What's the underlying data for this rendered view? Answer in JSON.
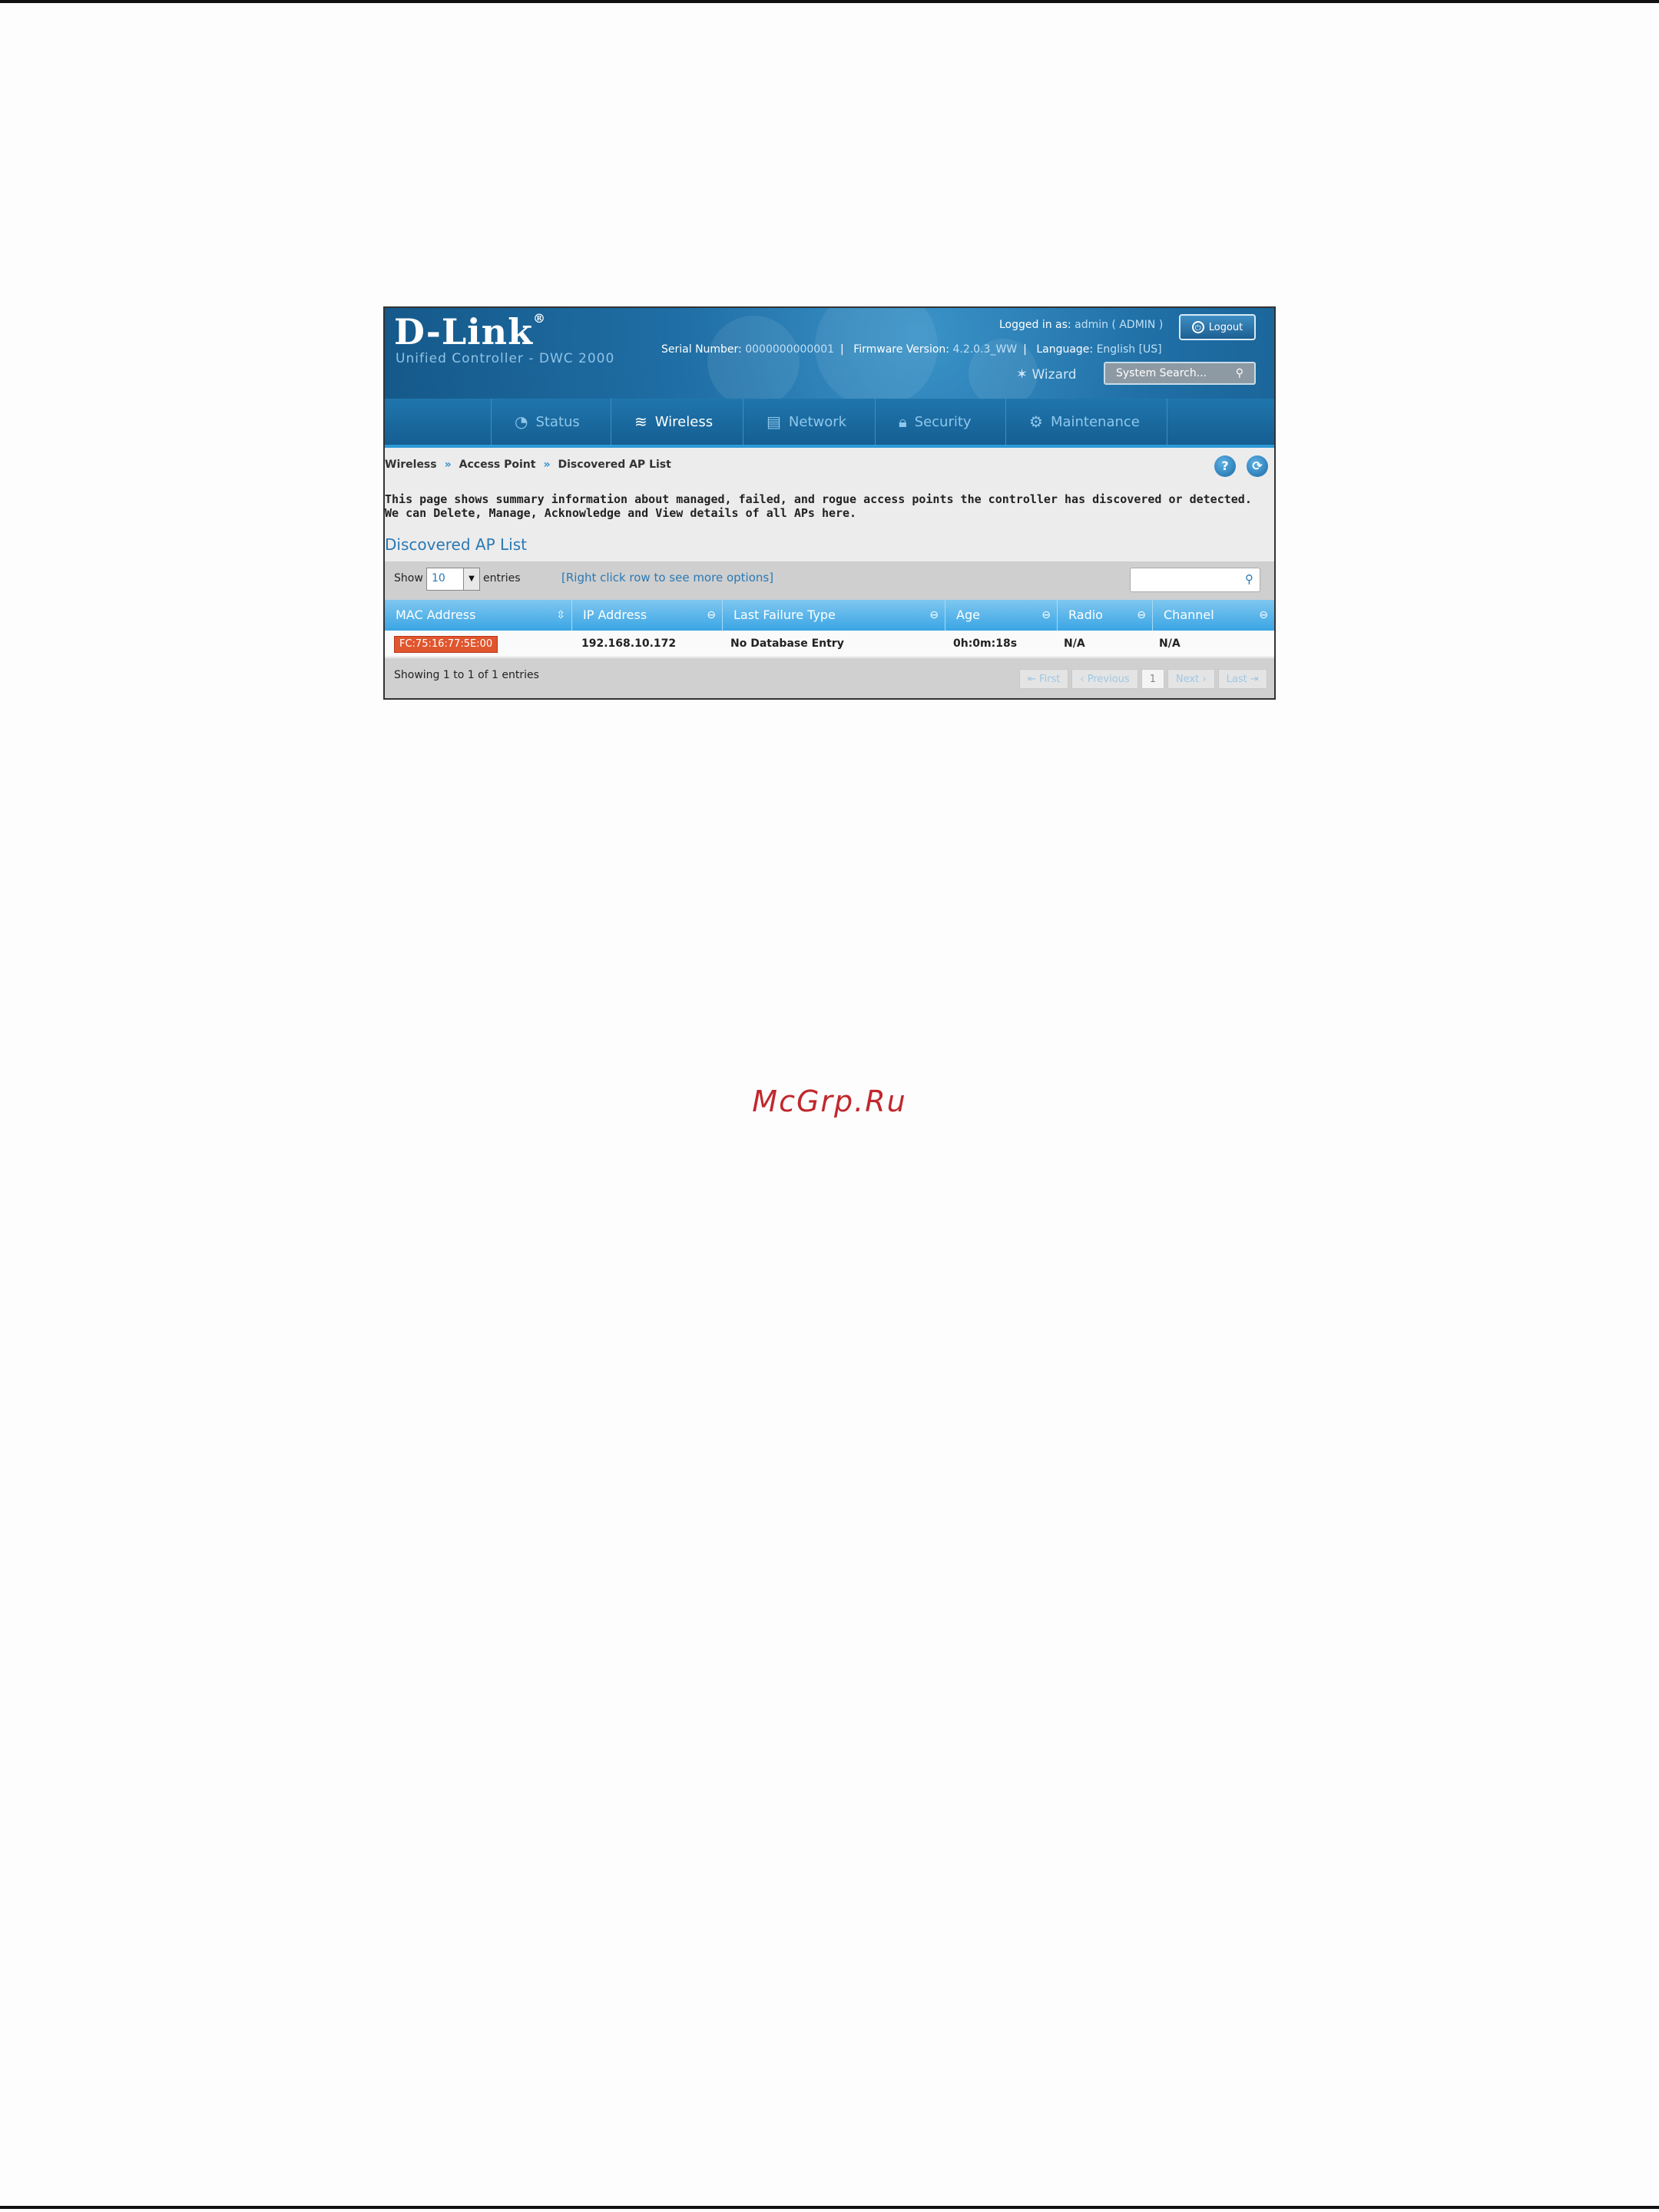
{
  "app": {
    "logo": "D-Link",
    "logo_mark": "®",
    "subtitle": "Unified Controller - DWC 2000"
  },
  "session": {
    "logged_in_label": "Logged in as:",
    "user": "admin ( ADMIN )",
    "logout_label": "Logout",
    "serial_label": "Serial Number:",
    "serial_value": "0000000000001",
    "firmware_label": "Firmware Version:",
    "firmware_value": "4.2.0.3_WW",
    "language_label": "Language:",
    "language_value": "English [US]",
    "wizard_label": "Wizard",
    "search_placeholder": "System Search..."
  },
  "nav": {
    "items": [
      {
        "label": "Status",
        "icon": "gauge-icon"
      },
      {
        "label": "Wireless",
        "icon": "wifi-icon",
        "active": true
      },
      {
        "label": "Network",
        "icon": "network-icon"
      },
      {
        "label": "Security",
        "icon": "lock-icon"
      },
      {
        "label": "Maintenance",
        "icon": "gears-icon"
      }
    ]
  },
  "breadcrumb": [
    "Wireless",
    "Access Point",
    "Discovered AP List"
  ],
  "breadcrumb_separator": "»",
  "description": "This page shows summary information about managed, failed, and rogue access points the controller has discovered or detected. We can Delete, Manage, Acknowledge and View details of all APs here.",
  "section_title": "Discovered AP List",
  "table_controls": {
    "show_label": "Show",
    "show_value": "10",
    "entries_label": "entries",
    "hint": "[Right click row to see more options]"
  },
  "table": {
    "columns": [
      "MAC Address",
      "IP Address",
      "Last Failure Type",
      "Age",
      "Radio",
      "Channel"
    ],
    "rows": [
      {
        "mac": "FC:75:16:77:5E:00",
        "ip": "192.168.10.172",
        "failure": "No Database Entry",
        "age": "0h:0m:18s",
        "radio": "N/A",
        "channel": "N/A"
      }
    ]
  },
  "footer": {
    "showing": "Showing 1 to 1 of 1 entries",
    "pager": {
      "first": "First",
      "previous": "Previous",
      "current": "1",
      "next": "Next",
      "last": "Last"
    }
  },
  "watermark": "McGrp.Ru",
  "colors": {
    "header_blue": "#1f6ea5",
    "accent_blue": "#2a79b5",
    "mac_badge": "#e0562e",
    "watermark_red": "#c0282d"
  }
}
